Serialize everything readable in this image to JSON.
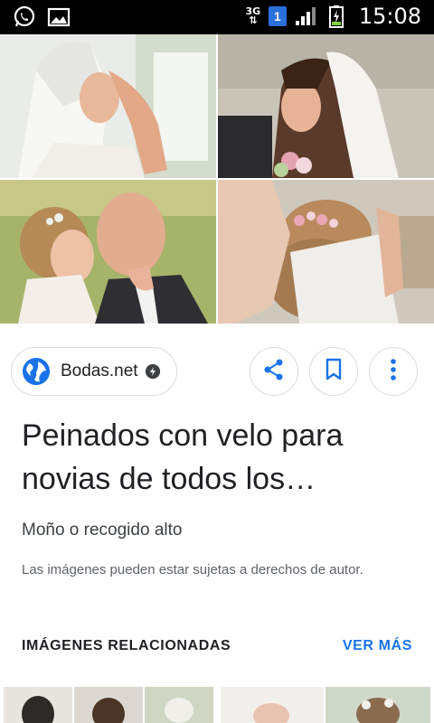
{
  "status_bar": {
    "network": "3G",
    "sim_slot": "1",
    "time": "15:08",
    "icons": [
      "whatsapp-icon",
      "gallery-icon",
      "signal-icon",
      "battery-charging-icon"
    ]
  },
  "images": [
    {
      "name": "image-bride-lace-veil"
    },
    {
      "name": "image-bride-long-veil"
    },
    {
      "name": "image-couple-kissing"
    },
    {
      "name": "image-updo-flowers-veil"
    }
  ],
  "source": {
    "name": "Bodas.net",
    "icons": [
      "globe-icon",
      "amp-icon"
    ]
  },
  "actions": [
    {
      "name": "share-button",
      "icon": "share-icon"
    },
    {
      "name": "bookmark-button",
      "icon": "bookmark-icon"
    },
    {
      "name": "more-options-button",
      "icon": "more-vert-icon"
    }
  ],
  "content": {
    "title_line1": "Peinados con velo para",
    "title_line2": "novias de todos los…",
    "subtitle": "Moño o recogido alto",
    "copyright": "Las imágenes pueden estar sujetas a derechos de autor."
  },
  "related": {
    "title": "IMÁGENES RELACIONADAS",
    "more": "VER MÁS"
  },
  "colors": {
    "accent": "#1a73e8",
    "status_bar": "#000000",
    "border": "#dadce0"
  }
}
